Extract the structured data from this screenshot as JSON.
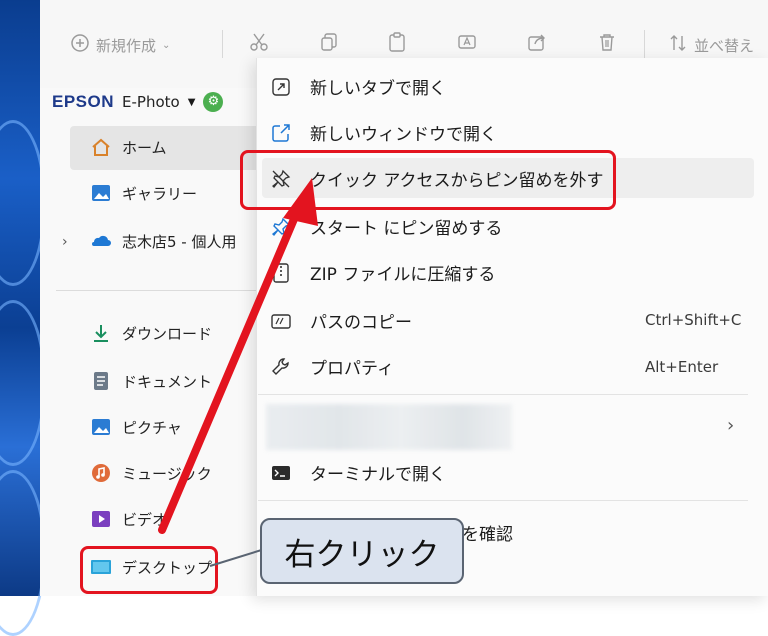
{
  "toolbar": {
    "new_label": "新規作成",
    "sort_label": "並べ替え"
  },
  "sidebar": {
    "account": {
      "logo": "EPSON",
      "name": "E-Photo"
    },
    "items": [
      {
        "label": "ホーム",
        "icon": "home-icon"
      },
      {
        "label": "ギャラリー",
        "icon": "gallery-icon"
      },
      {
        "label": "志木店5 - 個人用",
        "icon": "onedrive-cloud-icon"
      },
      {
        "label": "ダウンロード",
        "icon": "download-icon"
      },
      {
        "label": "ドキュメント",
        "icon": "document-icon"
      },
      {
        "label": "ピクチャ",
        "icon": "pictures-icon"
      },
      {
        "label": "ミュージック",
        "icon": "music-icon"
      },
      {
        "label": "ビデオ",
        "icon": "video-icon"
      },
      {
        "label": "デスクトップ",
        "icon": "desktop-icon"
      }
    ]
  },
  "context_menu": {
    "items": [
      {
        "label": "新しいタブで開く",
        "icon": "open-in-new-tab-icon"
      },
      {
        "label": "新しいウィンドウで開く",
        "icon": "open-in-new-window-icon"
      },
      {
        "label": "クイック アクセスからピン留めを外す",
        "icon": "unpin-icon"
      },
      {
        "label": "スタート にピン留めする",
        "icon": "pin-icon"
      },
      {
        "label": "ZIP ファイルに圧縮する",
        "icon": "zip-icon"
      },
      {
        "label": "パスのコピー",
        "icon": "copy-path-icon",
        "shortcut": "Ctrl+Shift+C"
      },
      {
        "label": "プロパティ",
        "icon": "properties-wrench-icon",
        "shortcut": "Alt+Enter"
      },
      {
        "label": "ターミナルで開く",
        "icon": "terminal-icon"
      },
      {
        "label": "を確認",
        "icon": ""
      }
    ]
  },
  "annotation": {
    "callout_text": "右クリック",
    "highlight_color": "#e3141f"
  }
}
